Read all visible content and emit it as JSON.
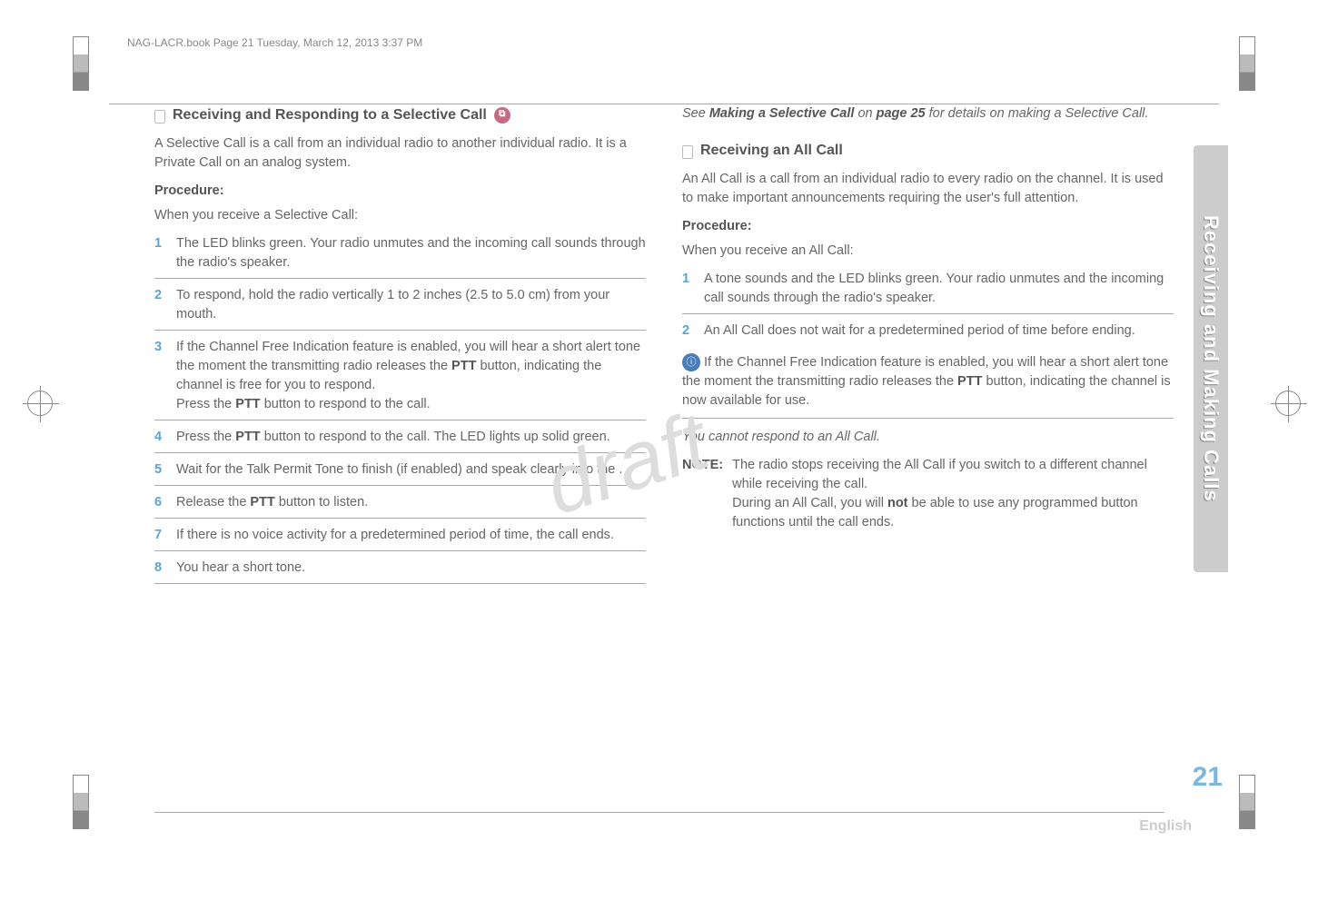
{
  "header": "NAG-LACR.book  Page 21  Tuesday, March 12, 2013  3:37 PM",
  "watermark": "draft",
  "left": {
    "title": "Receiving and Responding to a Selective Call",
    "intro": "A Selective Call is a call from an individual radio to another individual radio. It is a Private Call on an analog system.",
    "procedure_label": "Procedure:",
    "procedure_intro": "When you receive a Selective Call:",
    "steps": [
      "The LED blinks green. Your radio unmutes and the incoming call sounds through the radio's speaker.",
      "To respond, hold the radio vertically 1 to 2 inches (2.5 to 5.0 cm) from your mouth.",
      "If the Channel Free Indication feature is enabled, you will hear a short alert tone the moment the transmitting radio releases the PTT button, indicating the channel is free for you to respond.\nPress the PTT button to respond to the call.",
      "Press the PTT button to respond to the call. The LED lights up solid green.",
      "Wait for the Talk Permit Tone to finish (if enabled) and speak clearly into the .",
      "Release the PTT button to listen.",
      "If there is no voice activity for a predetermined period of time, the call ends.",
      "You hear a short tone."
    ]
  },
  "right": {
    "see_ref_prefix": "See ",
    "see_ref_bold1": "Making a Selective Call",
    "see_ref_mid": " on ",
    "see_ref_bold2": "page 25",
    "see_ref_suffix": " for details on making a Selective Call.",
    "title": "Receiving an All Call",
    "intro": "An All Call is a call from an individual radio to every radio on the channel. It is used to make important announcements requiring the user's full attention.",
    "procedure_label": "Procedure:",
    "procedure_intro": "When you receive an All Call:",
    "steps": [
      "A tone sounds and the LED blinks green. Your radio unmutes and the incoming call sounds through the radio's speaker.",
      "An All Call does not wait for a predetermined period of time before ending."
    ],
    "info_para": " If the Channel Free Indication feature is enabled, you will hear a short alert tone the moment the transmitting radio releases the PTT button, indicating the channel is now available for use.",
    "cannot": "You cannot respond to an All Call.",
    "note_label": "NOTE:",
    "note_text": "The radio stops receiving the All Call if you switch to a different channel while receiving the call. During an All Call, you will not be able to use any programmed button functions until the call ends."
  },
  "side_tab": "Receiving and Making Calls",
  "page_number": "21",
  "language": "English"
}
